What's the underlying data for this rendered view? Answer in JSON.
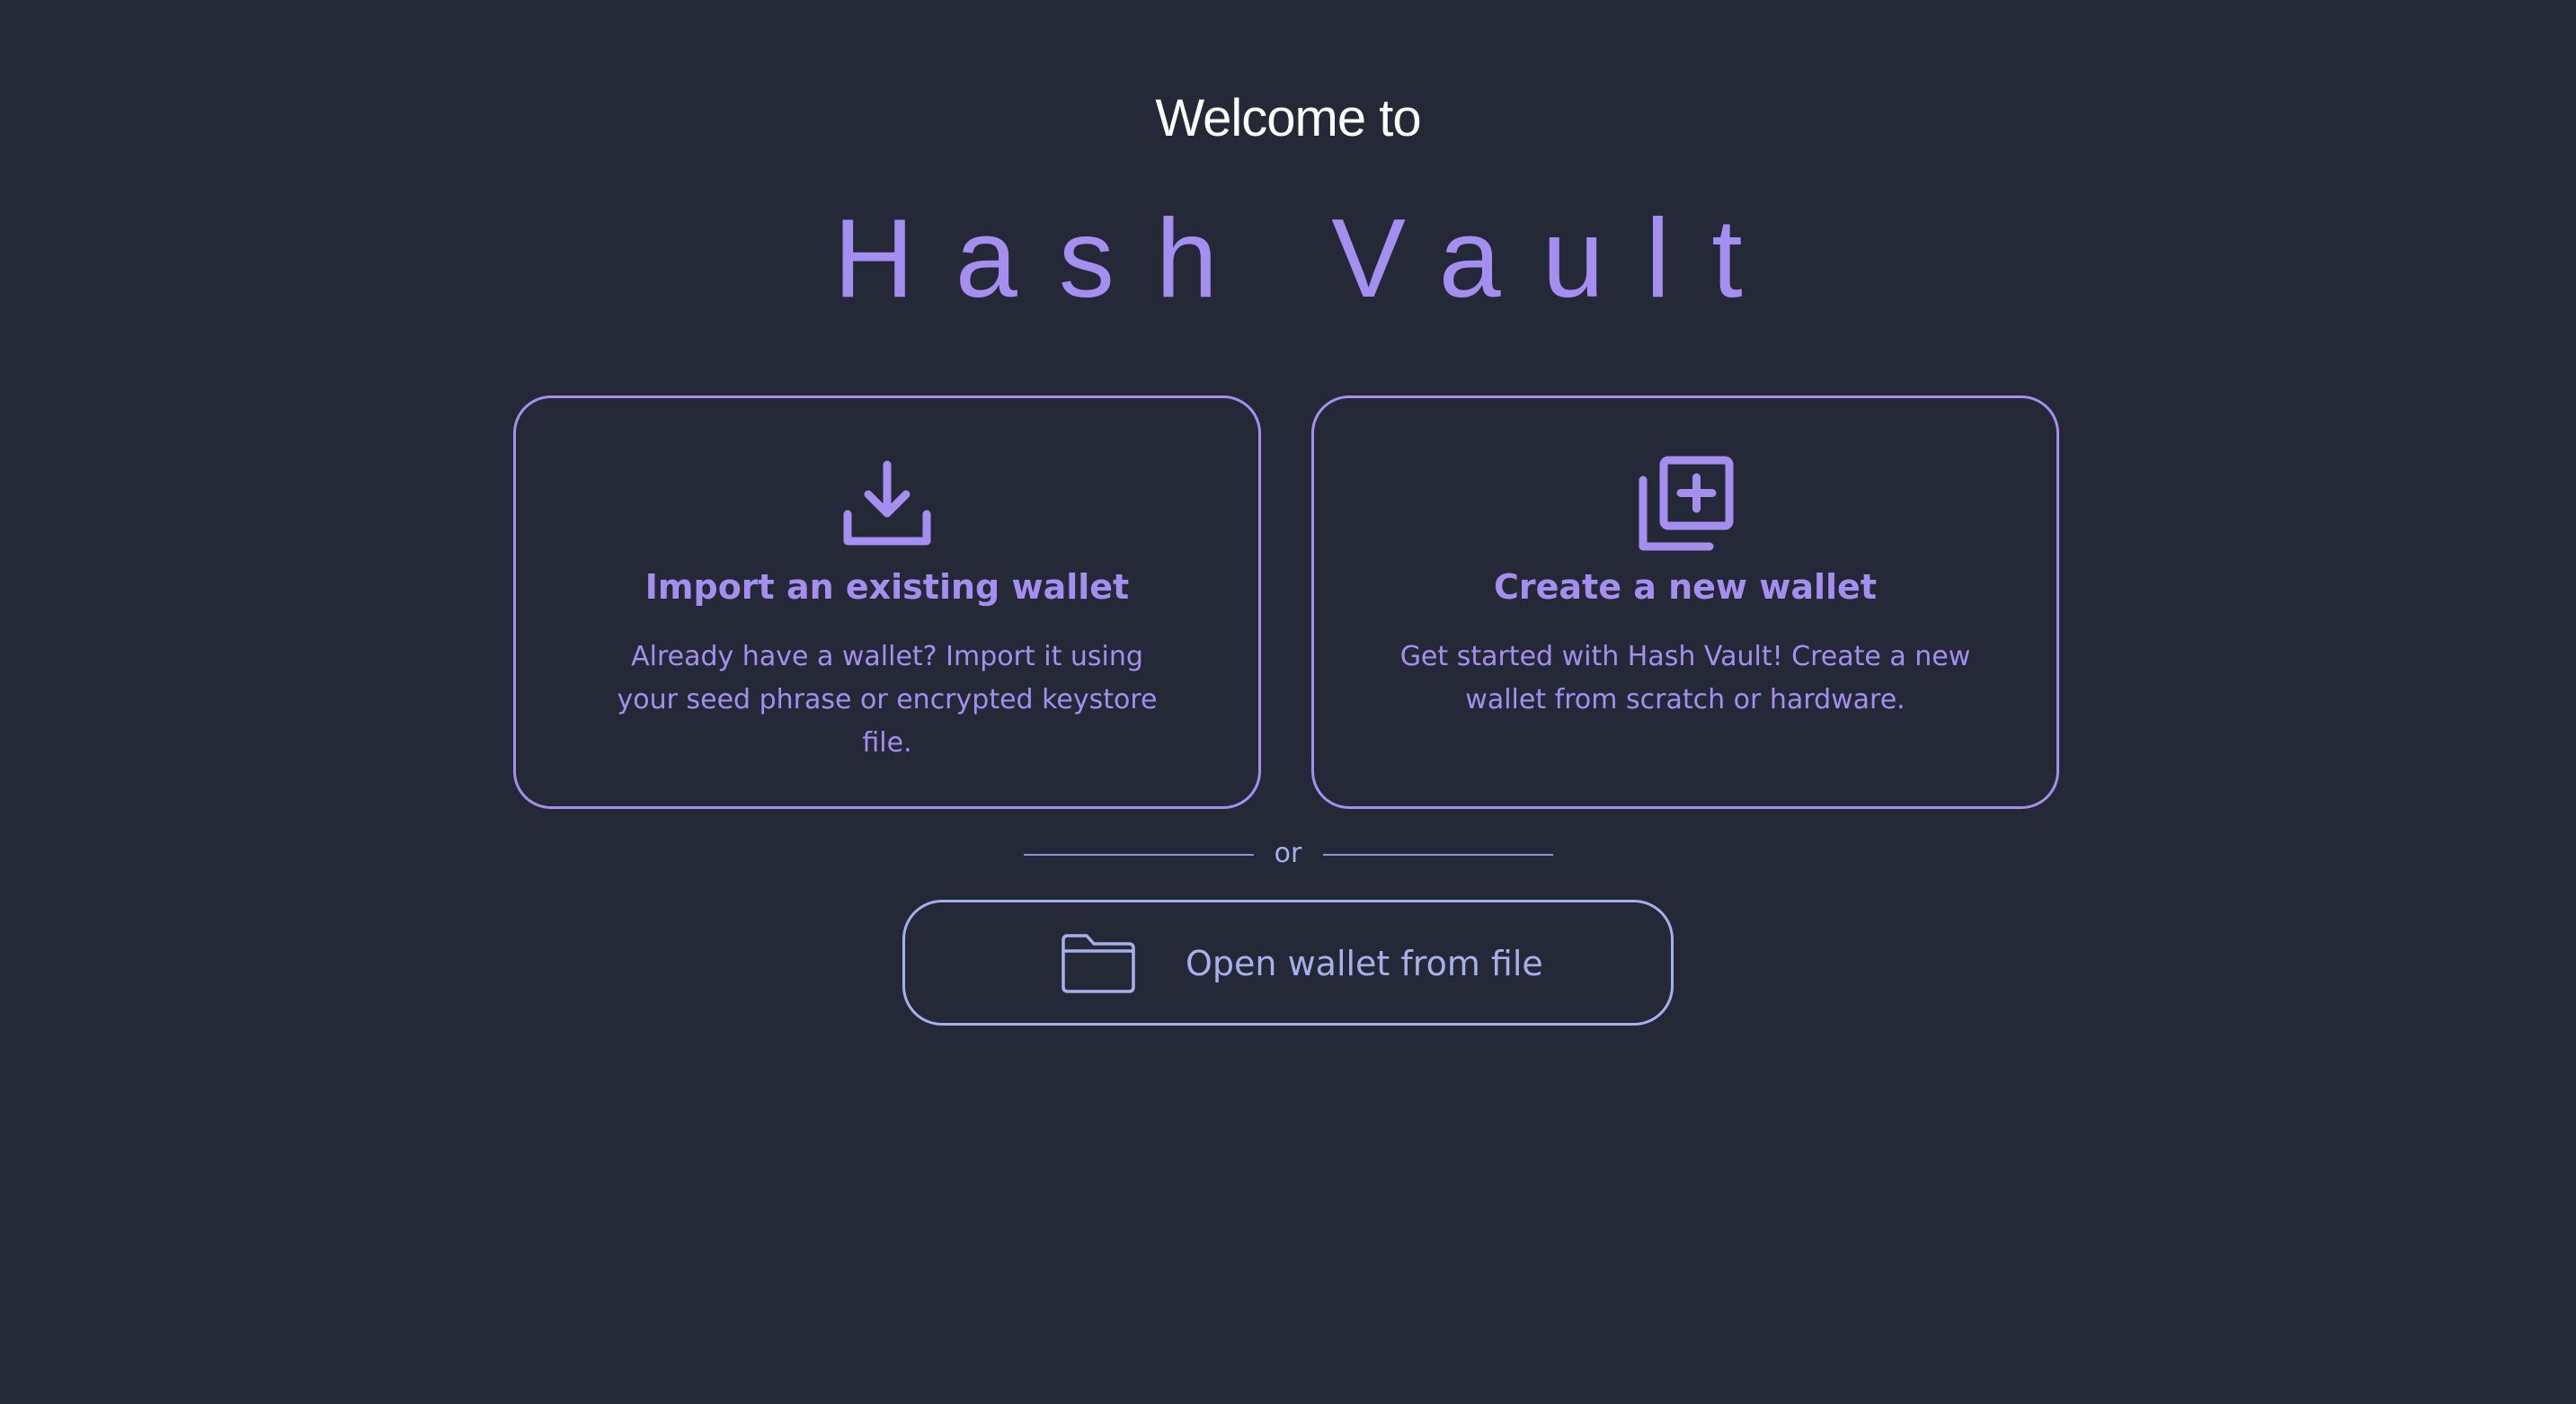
{
  "app": {
    "welcome": "Welcome to",
    "brand": "Hash Vault"
  },
  "cards": {
    "import": {
      "icon": "download-icon",
      "title": "Import an existing wallet",
      "description": "Already have a wallet? Import it using your seed phrase or encrypted keystore file."
    },
    "create": {
      "icon": "add-copy-icon",
      "title": "Create a new wallet",
      "description": "Get started with Hash Vault! Create a new wallet from scratch or hardware."
    }
  },
  "separator": {
    "text": "or"
  },
  "open_file": {
    "icon": "folder-icon",
    "label": "Open wallet from file"
  },
  "colors": {
    "background": "#242837",
    "accent": "#a48ff0",
    "secondary": "#a7b0ea",
    "heading": "#ffffff"
  }
}
